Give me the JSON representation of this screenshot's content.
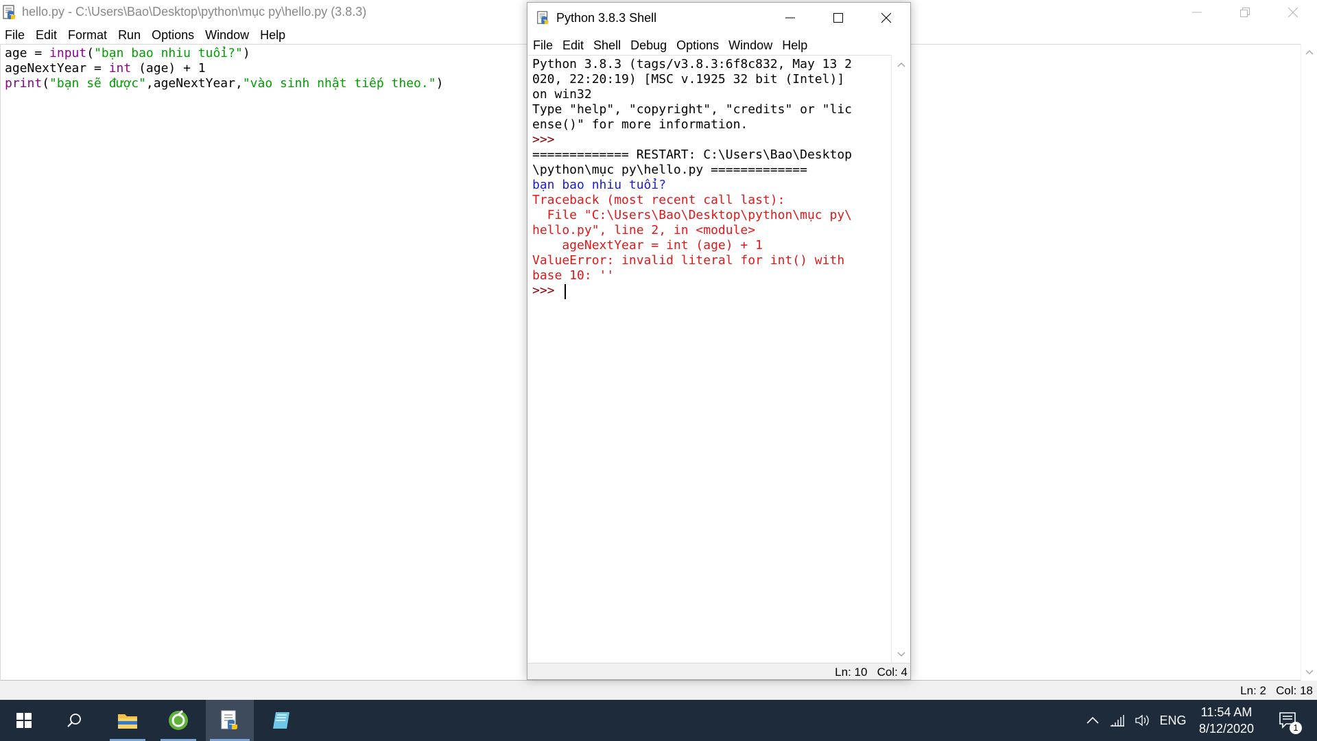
{
  "editor": {
    "title": "hello.py - C:\\Users\\Bao\\Desktop\\python\\mục py\\hello.py (3.8.3)",
    "menu": [
      "File",
      "Edit",
      "Format",
      "Run",
      "Options",
      "Window",
      "Help"
    ],
    "code": [
      [
        {
          "t": "age = ",
          "c": "plain"
        },
        {
          "t": "input",
          "c": "builtin"
        },
        {
          "t": "(",
          "c": "plain"
        },
        {
          "t": "\"bạn bao nhiu tuổi?\"",
          "c": "string"
        },
        {
          "t": ")",
          "c": "plain"
        }
      ],
      [
        {
          "t": "ageNextYear = ",
          "c": "plain"
        },
        {
          "t": "int",
          "c": "builtin"
        },
        {
          "t": " (age) + 1",
          "c": "plain"
        }
      ],
      [
        {
          "t": "print",
          "c": "builtin"
        },
        {
          "t": "(",
          "c": "plain"
        },
        {
          "t": "\"bạn sẽ được\"",
          "c": "string"
        },
        {
          "t": ",ageNextYear,",
          "c": "plain"
        },
        {
          "t": "\"vào sinh nhật tiếp theo.\"",
          "c": "string"
        },
        {
          "t": ")",
          "c": "plain"
        }
      ]
    ],
    "status": "Ln: 2   Col: 18"
  },
  "shell": {
    "title": "Python 3.8.3 Shell",
    "menu": [
      "File",
      "Edit",
      "Shell",
      "Debug",
      "Options",
      "Window",
      "Help"
    ],
    "lines": [
      {
        "t": "Python 3.8.3 (tags/v3.8.3:6f8c832, May 13 2",
        "c": "plain"
      },
      {
        "t": "020, 22:20:19) [MSC v.1925 32 bit (Intel)]",
        "c": "plain"
      },
      {
        "t": "on win32",
        "c": "plain"
      },
      {
        "t": "Type \"help\", \"copyright\", \"credits\" or \"lic",
        "c": "plain"
      },
      {
        "t": "ense()\" for more information.",
        "c": "plain"
      },
      {
        "t": ">>>",
        "c": "prompt"
      },
      {
        "t": "============= RESTART: C:\\Users\\Bao\\Desktop",
        "c": "plain"
      },
      {
        "t": "\\python\\mục py\\hello.py =============",
        "c": "plain"
      },
      {
        "t": "bạn bao nhiu tuổi?",
        "c": "stdout"
      },
      {
        "t": "Traceback (most recent call last):",
        "c": "err"
      },
      {
        "t": "  File \"C:\\Users\\Bao\\Desktop\\python\\mục py\\",
        "c": "err"
      },
      {
        "t": "hello.py\", line 2, in <module>",
        "c": "err"
      },
      {
        "t": "    ageNextYear = int (age) + 1",
        "c": "err"
      },
      {
        "t": "ValueError: invalid literal for int() with",
        "c": "err"
      },
      {
        "t": "base 10: ''",
        "c": "err"
      },
      {
        "t": ">>> ",
        "c": "prompt"
      }
    ],
    "status": "Ln: 10   Col: 4"
  },
  "taskbar": {
    "lang": "ENG",
    "time": "11:54 AM",
    "date": "8/12/2020",
    "notification_count": "1"
  },
  "colors": {
    "taskbar": "#1d2b3a",
    "builtin": "#900090",
    "string": "#00a000",
    "error": "#e11818",
    "stdout": "#1a1adb",
    "prompt": "#8b0000"
  }
}
